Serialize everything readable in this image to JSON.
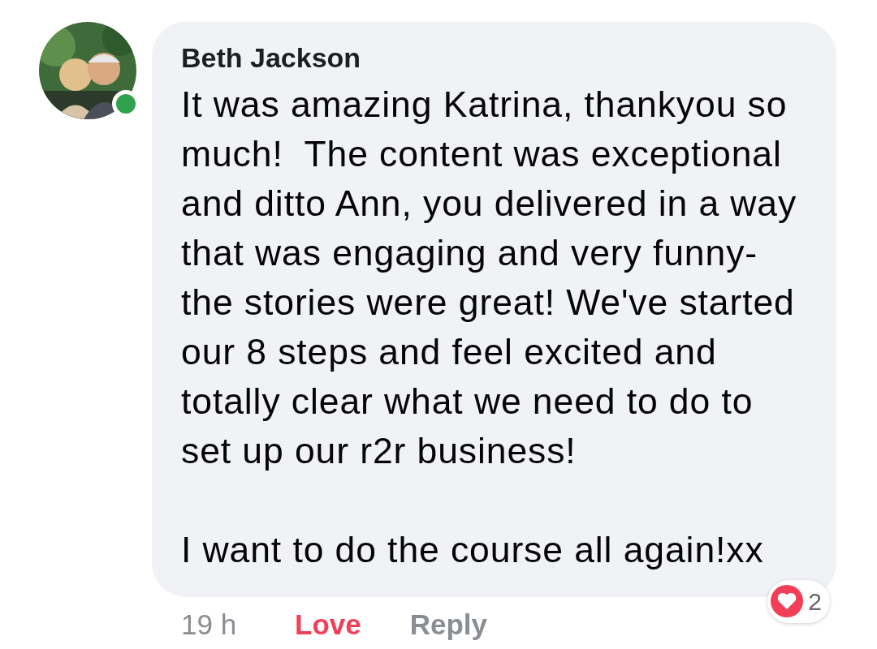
{
  "comment": {
    "author": "Beth Jackson",
    "online": true,
    "paragraphs": [
      "It was amazing Katrina, thankyou so much!  The content was exceptional and ditto Ann, you delivered in a way that was engaging and very funny- the stories were great! We've started our 8 steps and feel excited and totally clear what we need to do to set up our r2r business!",
      "I want to do the course all again!xx"
    ],
    "time": "19 h",
    "actions": [
      {
        "label": "Love",
        "selected": true
      },
      {
        "label": "Reply",
        "selected": false
      }
    ],
    "reactions": {
      "count": "2"
    }
  }
}
